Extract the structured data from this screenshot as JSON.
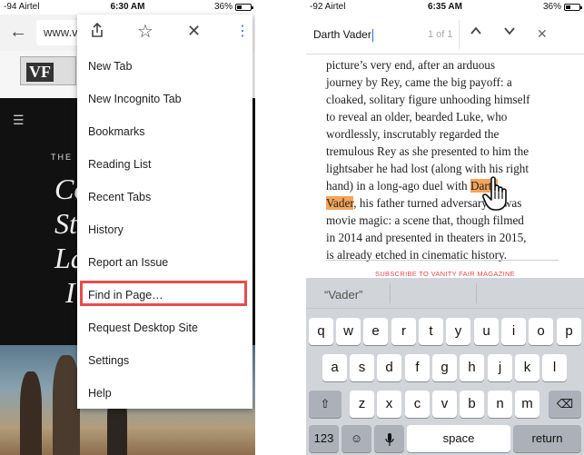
{
  "left_phone": {
    "status": {
      "carrier": "-94 Airtel",
      "time": "6:30 AM",
      "battery": "36%"
    },
    "toolbar": {
      "url": "www.v"
    },
    "page": {
      "logo": "VF",
      "hero_small": "THE L",
      "hero_words": [
        "Co",
        "Sta",
        "La",
        "I"
      ]
    },
    "menu": {
      "icons": [
        "share-icon",
        "star-icon",
        "close-icon",
        "more-vert-icon"
      ],
      "items": [
        "New Tab",
        "New Incognito Tab",
        "Bookmarks",
        "Reading List",
        "Recent Tabs",
        "History",
        "Report an Issue",
        "Find in Page…",
        "Request Desktop Site",
        "Settings",
        "Help"
      ],
      "highlighted_item": "Find in Page…",
      "highlight_color": "#e74c4c"
    }
  },
  "right_phone": {
    "status": {
      "carrier": "-92 Airtel",
      "time": "6:35 AM",
      "battery": "36%"
    },
    "findbar": {
      "query": "Darth Vader",
      "count": "1 of 1",
      "prev_icon": "chevron-up-icon",
      "next_icon": "chevron-down-icon",
      "close_icon": "close-icon"
    },
    "article": {
      "lines": [
        {
          "text": "picture’s very end, after an arduous"
        },
        {
          "text": "journey by Rey, came the big payoff: a"
        },
        {
          "text": "cloaked, solitary figure unhooding himself"
        },
        {
          "text": "to reveal an older, bearded Luke, who"
        },
        {
          "text": "wordlessly, inscrutably regarded the"
        },
        {
          "text": "tremulous Rey as she presented to him the"
        },
        {
          "text": "lightsaber he had lost (along with his right"
        },
        {
          "pre": "hand) in a long-ago duel with ",
          "hl": "Darth",
          "post": ""
        },
        {
          "pre": "",
          "hl": "Vader",
          "post": ", his father turned adversary. It was"
        },
        {
          "text": "movie magic: a scene that, though filmed"
        },
        {
          "text": "in 2014 and presented in theaters in 2015,"
        },
        {
          "text": "is already etched in cinematic history."
        }
      ],
      "highlight_color": "#f5a55a",
      "subscribe": "SUBSCRIBE TO VANITY FAIR MAGAZINE"
    },
    "keyboard": {
      "suggestion": "“Vader”",
      "row1": [
        "q",
        "w",
        "e",
        "r",
        "t",
        "y",
        "u",
        "i",
        "o",
        "p"
      ],
      "row2": [
        "a",
        "s",
        "d",
        "f",
        "g",
        "h",
        "j",
        "k",
        "l"
      ],
      "row3": [
        "z",
        "x",
        "c",
        "v",
        "b",
        "n",
        "m"
      ],
      "shift_icon": "shift-icon",
      "delete_icon": "backspace-icon",
      "numbers_label": "123",
      "emoji_icon": "emoji-icon",
      "mic_icon": "microphone-icon",
      "space_label": "space",
      "return_label": "return"
    }
  }
}
